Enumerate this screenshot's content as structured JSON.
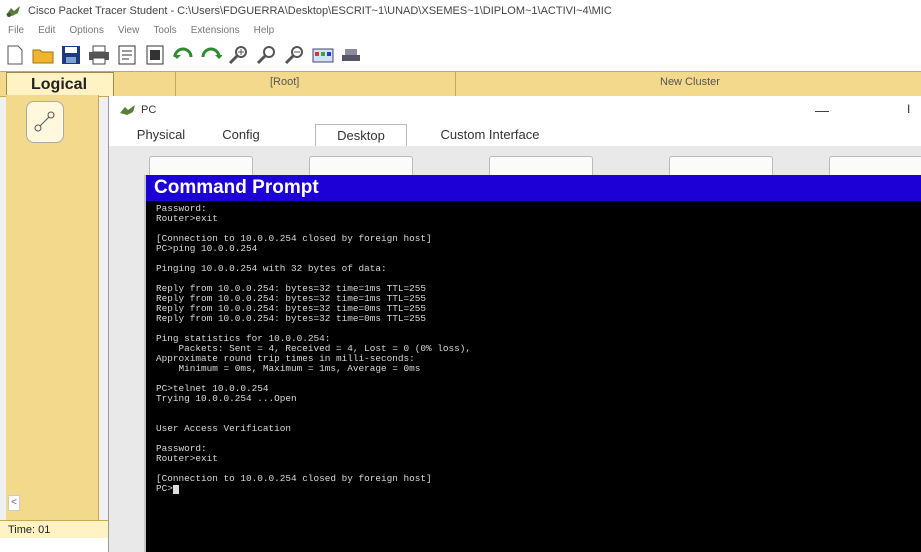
{
  "window": {
    "title": "Cisco Packet Tracer Student - C:\\Users\\FDGUERRA\\Desktop\\ESCRIT~1\\UNAD\\XSEMES~1\\DIPLOM~1\\ACTIVI~4\\MIC"
  },
  "menu": [
    "File",
    "Edit",
    "Options",
    "View",
    "Tools",
    "Extensions",
    "Help"
  ],
  "toolbar_icons": [
    "new-file-icon",
    "open-folder-icon",
    "save-icon",
    "print-icon",
    "activity-wizard-icon",
    "inspect-icon",
    "draw-icon",
    "undo-icon",
    "redo-icon",
    "zoom-in-icon",
    "zoom-reset-icon",
    "zoom-out-icon",
    "palette-icon",
    "custom-device-icon"
  ],
  "logical_bar": {
    "label": "Logical",
    "root": "[Root]",
    "cluster": "New Cluster"
  },
  "left_panel": {
    "time_label": "Time: 01",
    "scroll_arrow": "<"
  },
  "pc_window": {
    "title": "PC",
    "minimize": "—",
    "tabs": [
      "Physical",
      "Config",
      "Desktop",
      "Custom Interface"
    ],
    "active_tab": "Desktop"
  },
  "command_prompt": {
    "title": "Command Prompt",
    "lines": [
      "Password:",
      "Router>exit",
      "",
      "[Connection to 10.0.0.254 closed by foreign host]",
      "PC>ping 10.0.0.254",
      "",
      "Pinging 10.0.0.254 with 32 bytes of data:",
      "",
      "Reply from 10.0.0.254: bytes=32 time=1ms TTL=255",
      "Reply from 10.0.0.254: bytes=32 time=1ms TTL=255",
      "Reply from 10.0.0.254: bytes=32 time=0ms TTL=255",
      "Reply from 10.0.0.254: bytes=32 time=0ms TTL=255",
      "",
      "Ping statistics for 10.0.0.254:",
      "    Packets: Sent = 4, Received = 4, Lost = 0 (0% loss),",
      "Approximate round trip times in milli-seconds:",
      "    Minimum = 0ms, Maximum = 1ms, Average = 0ms",
      "",
      "PC>telnet 10.0.0.254",
      "Trying 10.0.0.254 ...Open",
      "",
      "",
      "User Access Verification",
      "",
      "Password:",
      "Router>exit",
      "",
      "[Connection to 10.0.0.254 closed by foreign host]",
      "PC>"
    ]
  },
  "colors": {
    "cmd_title_bg": "#1c00d6",
    "logical_bar_bg": "#f3d98c",
    "terminal_bg": "#000000",
    "terminal_text": "#d8d8d8"
  }
}
